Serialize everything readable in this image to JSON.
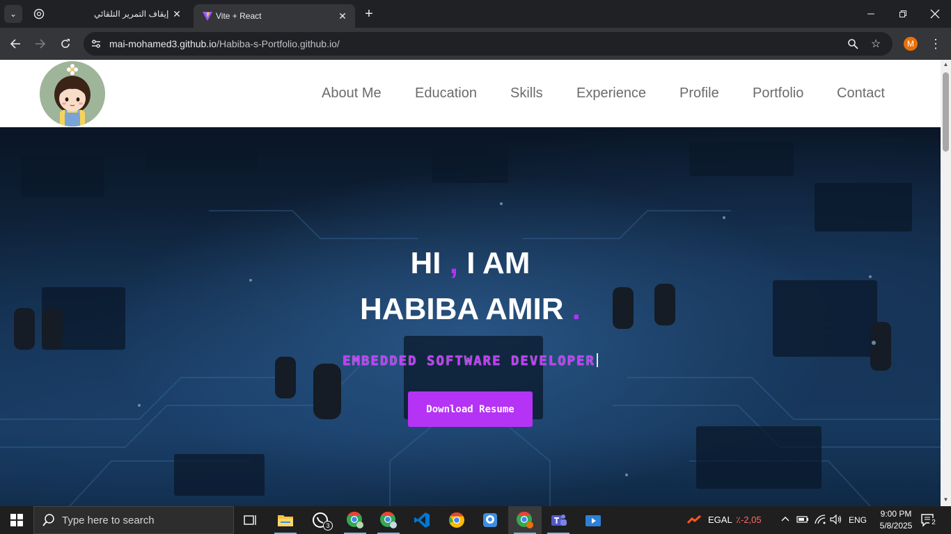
{
  "browser": {
    "tabs": [
      {
        "title": "إيقاف التمرير التلقائي",
        "active": false
      },
      {
        "title": "Vite + React",
        "active": true
      }
    ],
    "url_host": "mai-mohamed3.github.io",
    "url_path": "/Habiba-s-Portfolio.github.io/",
    "profile_initial": "M"
  },
  "site": {
    "nav": [
      "About Me",
      "Education",
      "Skills",
      "Experience",
      "Profile",
      "Portfolio",
      "Contact"
    ],
    "hero": {
      "greeting_hi": "HI",
      "greeting_comma": ",",
      "greeting_iam": "I AM",
      "name": "HABIBA AMIR",
      "name_dot": ".",
      "role": "EMBEDDED SOFTWARE DEVELOPER",
      "button": "Download Resume"
    },
    "colors": {
      "accent": "#b533f5",
      "nav_text": "#6b6b6b"
    }
  },
  "taskbar": {
    "search_placeholder": "Type here to search",
    "whatsapp_badge": "3",
    "stock_symbol": "EGAL",
    "stock_change": "2,05-٪",
    "language": "ENG",
    "time": "9:00 PM",
    "date": "5/8/2025",
    "notification_count": "2",
    "apps": [
      "task-view",
      "file-explorer",
      "whatsapp",
      "chrome-profile-m",
      "chrome-profile-y",
      "vscode",
      "chrome",
      "webcam-app",
      "chrome-active",
      "teams",
      "video-player"
    ]
  }
}
